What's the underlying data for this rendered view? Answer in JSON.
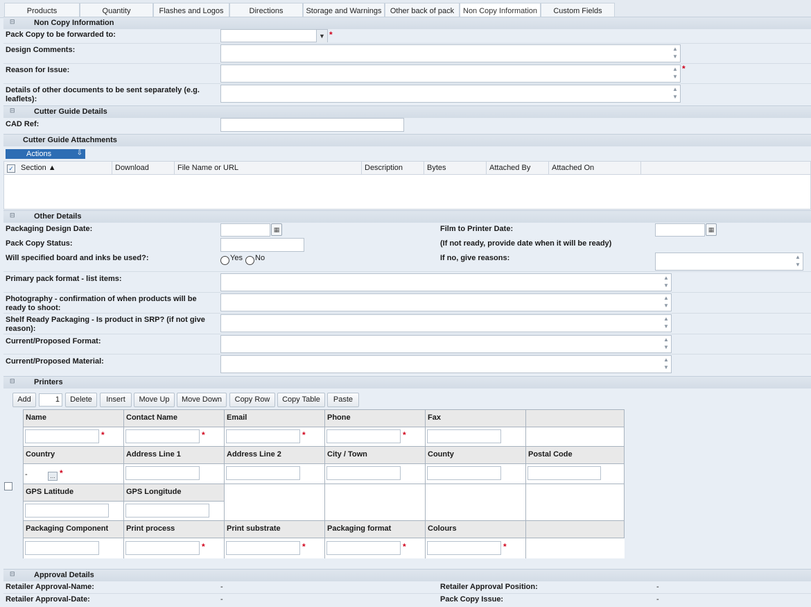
{
  "tabs": [
    {
      "label": "Products"
    },
    {
      "label": "Quantity"
    },
    {
      "label": "Flashes and Logos"
    },
    {
      "label": "Directions"
    },
    {
      "label": "Storage and Warnings"
    },
    {
      "label": "Other back of pack"
    },
    {
      "label": "Non Copy Information"
    },
    {
      "label": "Custom Fields"
    }
  ],
  "sections": {
    "non_copy": "Non Copy Information",
    "cutter_guide": "Cutter Guide Details",
    "attachments": "Cutter Guide Attachments",
    "other_details": "Other Details",
    "printers": "Printers",
    "approval": "Approval Details"
  },
  "non_copy": {
    "pack_copy_forward_label": "Pack Copy to be forwarded to:",
    "design_comments_label": "Design Comments:",
    "reason_for_issue_label": "Reason for Issue:",
    "details_docs_label_1": "Details of other documents to be sent separately (e.g.",
    "details_docs_label_2": "leaflets):"
  },
  "cutter_guide": {
    "cad_ref_label": "CAD Ref:"
  },
  "attachments": {
    "actions_label": "Actions",
    "columns": [
      "Section ▲",
      "Download",
      "File Name or URL",
      "Description",
      "Bytes",
      "Attached By",
      "Attached On"
    ]
  },
  "other_details": {
    "packaging_design_date": "Packaging Design Date:",
    "film_to_printer_date": "Film to Printer Date:",
    "pack_copy_status": "Pack Copy Status:",
    "not_ready_note": "(If not ready, provide date when it will be ready)",
    "board_inks": "Will specified board and inks be used?:",
    "yes": "Yes",
    "no": "No",
    "if_no_reasons": "If no, give reasons:",
    "primary_pack": "Primary pack format - list items:",
    "photo_1": "Photography - confirmation of when products will be",
    "photo_2": "ready to shoot:",
    "srp_1": "Shelf Ready Packaging - Is product in SRP? (if not give",
    "srp_2": "reason):",
    "current_format": "Current/Proposed Format:",
    "current_material": "Current/Proposed Material:"
  },
  "printers": {
    "toolbar": {
      "add": "Add",
      "count": "1",
      "delete": "Delete",
      "insert": "Insert",
      "move_up": "Move Up",
      "move_down": "Move Down",
      "copy_row": "Copy Row",
      "copy_table": "Copy Table",
      "paste": "Paste"
    },
    "row1": [
      "Name",
      "Contact Name",
      "Email",
      "Phone",
      "Fax"
    ],
    "row2": [
      "Country",
      "Address Line 1",
      "Address Line 2",
      "City / Town",
      "County",
      "Postal Code"
    ],
    "row3": [
      "GPS Latitude",
      "GPS Longitude"
    ],
    "row4": [
      "Packaging Component",
      "Print process",
      "Print substrate",
      "Packaging format",
      "Colours"
    ],
    "country_value": "-"
  },
  "approval": {
    "name_label": "Retailer Approval-Name:",
    "name_value": "-",
    "position_label": "Retailer Approval Position:",
    "position_value": "-",
    "date_label": "Retailer Approval-Date:",
    "date_value": "-",
    "issue_label": "Pack Copy Issue:",
    "issue_value": "-"
  },
  "colors": {
    "accent": "#2d6db4",
    "required": "#d0021b",
    "section_bg": "#d8e0e9"
  }
}
